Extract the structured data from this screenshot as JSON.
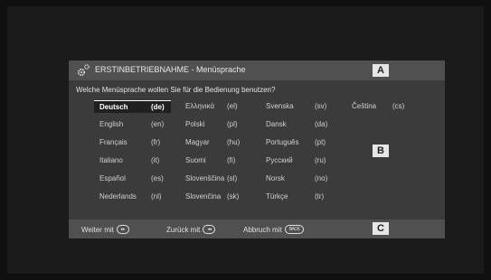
{
  "title": "ERSTINBETRIEBNAHME - Menüsprache",
  "question": "Welche Menüsprache wollen Sie für die Bedienung benutzen?",
  "markers": {
    "a": "A",
    "b": "B",
    "c": "C"
  },
  "languages": [
    [
      {
        "name": "Deutsch",
        "code": "(de)",
        "selected": true
      },
      {
        "name": "English",
        "code": "(en)"
      },
      {
        "name": "Français",
        "code": "(fr)"
      },
      {
        "name": "Italiano",
        "code": "(it)"
      },
      {
        "name": "Español",
        "code": "(es)"
      },
      {
        "name": "Nederlands",
        "code": "(nl)"
      }
    ],
    [
      {
        "name": "Ελληνικά",
        "code": "(el)"
      },
      {
        "name": "Polski",
        "code": "(pl)"
      },
      {
        "name": "Magyar",
        "code": "(hu)"
      },
      {
        "name": "Suomi",
        "code": "(fi)"
      },
      {
        "name": "Slovenščina",
        "code": "(sl)"
      },
      {
        "name": "Slovenčina",
        "code": "(sk)"
      }
    ],
    [
      {
        "name": "Svenska",
        "code": "(sv)"
      },
      {
        "name": "Dansk",
        "code": "(da)"
      },
      {
        "name": "Português",
        "code": "(pt)"
      },
      {
        "name": "Русский",
        "code": "(ru)"
      },
      {
        "name": "Norsk",
        "code": "(no)"
      },
      {
        "name": "Türkçe",
        "code": "(tr)"
      }
    ],
    [
      {
        "name": "Čeština",
        "code": "(cs)"
      }
    ]
  ],
  "footer": {
    "next": "Weiter mit",
    "next_key": "▸▸",
    "back": "Zurück mit",
    "back_key": "◂◂",
    "cancel": "Abbruch mit",
    "cancel_key": "BACK"
  }
}
